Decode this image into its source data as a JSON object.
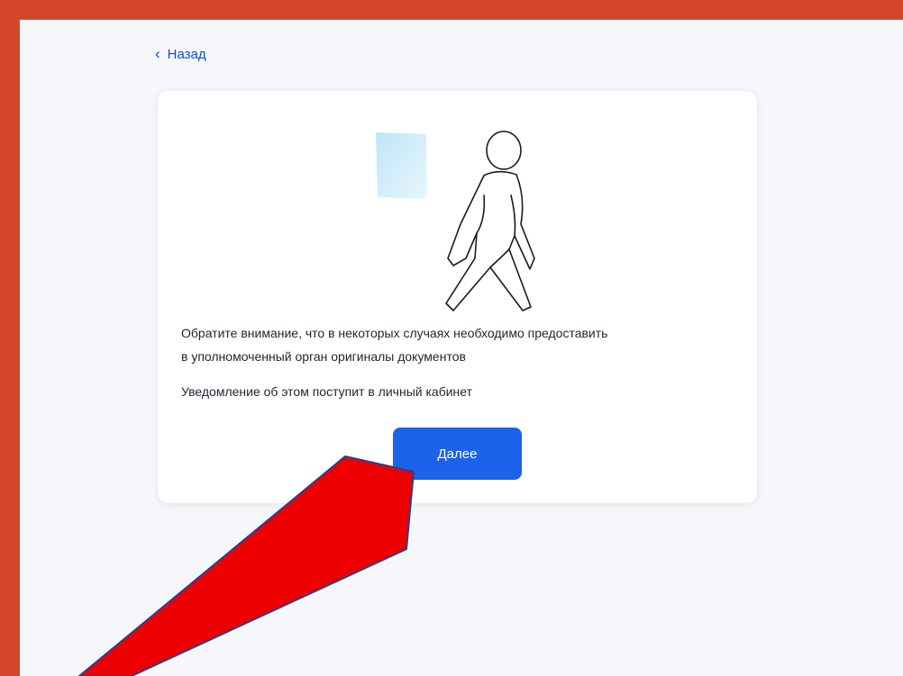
{
  "header": {
    "back_label": "Назад"
  },
  "card": {
    "notice_line_1": "Обратите внимание, что в некоторых случаях необходимо предоставить",
    "notice_line_2": "в уполномоченный орган оригиналы документов",
    "notification_text": "Уведомление об этом поступит в личный кабинет",
    "next_button_label": "Далее"
  },
  "icons": {
    "back": "chevron-left-icon",
    "illustration": "walking-person-icon",
    "document": "document-sheet-icon",
    "annotation": "red-arrow-annotation"
  },
  "colors": {
    "frame_border": "#d5472b",
    "page_background": "#f5f7fb",
    "card_background": "#ffffff",
    "link": "#0d4cd3",
    "primary_button": "#1c62ea",
    "annotation_arrow": "#ee0000"
  }
}
